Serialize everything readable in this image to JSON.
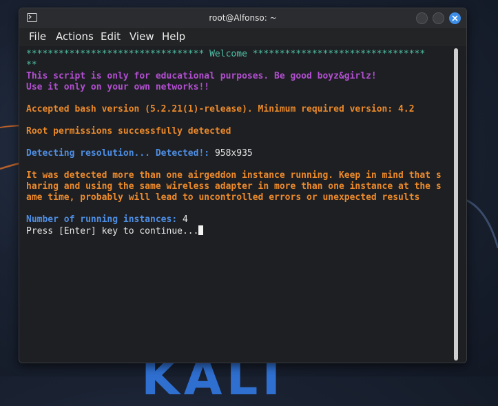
{
  "window": {
    "title": "root@Alfonso: ~"
  },
  "menu": [
    "File",
    "Actions",
    "Edit",
    "View",
    "Help"
  ],
  "terminal": {
    "welcome_line1": "********************************* Welcome ********************************",
    "welcome_line2": "**",
    "edu1": "This script is only for educational purposes. Be good boyz&girlz!",
    "edu2": "Use it only on your own networks!!",
    "bash": "Accepted bash version (5.2.21(1)-release). Minimum required version: 4.2",
    "root": "Root permissions successfully detected",
    "res_label": "Detecting resolution... Detected!: ",
    "res_value": "958x935",
    "warn1": "It was detected more than one airgeddon instance running. Keep in mind that s",
    "warn2": "haring and using the same wireless adapter in more than one instance at the s",
    "warn3": "ame time, probably will lead to uncontrolled errors or unexpected results",
    "instances_label": "Number of running instances: ",
    "instances_value": "4",
    "prompt": "Press [Enter] key to continue..."
  },
  "desktop": {
    "logo_text": "KALI"
  },
  "colors": {
    "cyan": "#4fc1a8",
    "purple": "#b24fd1",
    "orange": "#ec8a2b",
    "blue": "#4e8ee4",
    "close_button": "#3d8ee8"
  }
}
